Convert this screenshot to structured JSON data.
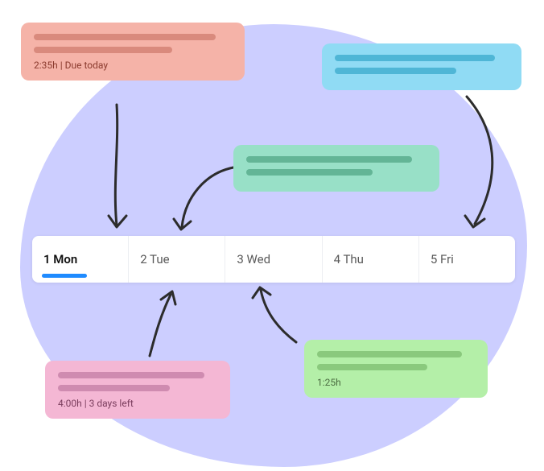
{
  "cards": {
    "red": {
      "meta": "2:35h | Due today"
    },
    "blue": {
      "meta": ""
    },
    "teal": {
      "meta": ""
    },
    "pink": {
      "meta": "4:00h | 3 days left"
    },
    "green": {
      "meta": "1:25h"
    }
  },
  "week": {
    "days": [
      {
        "label": "1 Mon",
        "active": true
      },
      {
        "label": "2 Tue",
        "active": false
      },
      {
        "label": "3 Wed",
        "active": false
      },
      {
        "label": "4 Thu",
        "active": false
      },
      {
        "label": "5 Fri",
        "active": false
      }
    ]
  }
}
